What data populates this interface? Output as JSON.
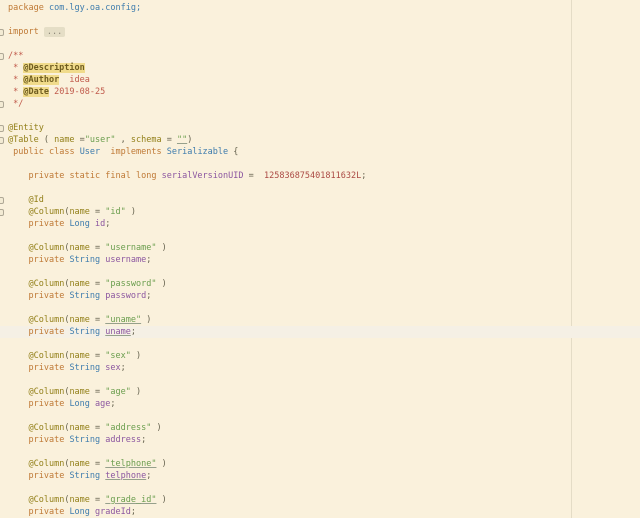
{
  "app": {
    "title": "code-editor-viewport"
  },
  "colors": {
    "background": "#FAF1DC",
    "caret_line": "#F5F0E5",
    "keyword": "#BF7935",
    "reference_type": "#3E7CAD",
    "annotation": "#93801A",
    "string": "#6B9E4E",
    "field": "#8C57A0",
    "number": "#AB4A44",
    "doc_comment": "#C05A4B",
    "doc_tag_text": "#6F5D20",
    "doc_tag_bg": "#F0DB8B",
    "punctuation": "#66634F",
    "margin_guide": "#E4DCC6"
  },
  "editor": {
    "language": "java",
    "caret_line_index": 27,
    "margin_guide_x": 571,
    "fold_marker_lines": [
      2,
      4,
      8,
      10,
      11,
      16,
      17
    ],
    "folded_imports_placeholder": "...",
    "lines": [
      {
        "tokens": [
          {
            "t": "kw",
            "s": "package"
          },
          {
            "t": "pln",
            "s": " "
          },
          {
            "t": "ref",
            "s": "com.lgy.oa.config;"
          }
        ]
      },
      {
        "tokens": []
      },
      {
        "tokens": [
          {
            "t": "kw",
            "s": "import"
          },
          {
            "t": "pln",
            "s": " "
          },
          {
            "t": "fold",
            "s": "..."
          }
        ]
      },
      {
        "tokens": []
      },
      {
        "tokens": [
          {
            "t": "doc",
            "s": "/**"
          }
        ]
      },
      {
        "tokens": [
          {
            "t": "doc",
            "s": " * "
          },
          {
            "t": "tag",
            "s": "@Description"
          }
        ]
      },
      {
        "tokens": [
          {
            "t": "doc",
            "s": " * "
          },
          {
            "t": "tag",
            "s": "@Author"
          },
          {
            "t": "doc",
            "s": "  idea"
          }
        ]
      },
      {
        "tokens": [
          {
            "t": "doc",
            "s": " * "
          },
          {
            "t": "tag",
            "s": "@Date"
          },
          {
            "t": "doc",
            "s": " 2019-08-25"
          }
        ]
      },
      {
        "tokens": [
          {
            "t": "doc",
            "s": " */"
          }
        ]
      },
      {
        "tokens": []
      },
      {
        "tokens": [
          {
            "t": "ann",
            "s": "@Entity"
          }
        ]
      },
      {
        "tokens": [
          {
            "t": "ann",
            "s": "@Table"
          },
          {
            "t": "pln",
            "s": " ( "
          },
          {
            "t": "ann",
            "s": "name"
          },
          {
            "t": "pln",
            "s": " ="
          },
          {
            "t": "str",
            "s": "\"user\""
          },
          {
            "t": "pln",
            "s": " , "
          },
          {
            "t": "ann",
            "s": "schema"
          },
          {
            "t": "pln",
            "s": " = "
          },
          {
            "t": "str",
            "s": "\"\"",
            "u": true
          },
          {
            "t": "pln",
            "s": ")"
          }
        ]
      },
      {
        "tokens": [
          {
            "t": "pln",
            "s": " "
          },
          {
            "t": "kw",
            "s": "public"
          },
          {
            "t": "pln",
            "s": " "
          },
          {
            "t": "kw",
            "s": "class"
          },
          {
            "t": "pln",
            "s": " "
          },
          {
            "t": "ref",
            "s": "User"
          },
          {
            "t": "pln",
            "s": "  "
          },
          {
            "t": "kw",
            "s": "implements"
          },
          {
            "t": "pln",
            "s": " "
          },
          {
            "t": "ref",
            "s": "Serializable"
          },
          {
            "t": "pln",
            "s": " {"
          }
        ]
      },
      {
        "tokens": []
      },
      {
        "tokens": [
          {
            "t": "pln",
            "s": "    "
          },
          {
            "t": "kw",
            "s": "private"
          },
          {
            "t": "pln",
            "s": " "
          },
          {
            "t": "kw",
            "s": "static"
          },
          {
            "t": "pln",
            "s": " "
          },
          {
            "t": "kw",
            "s": "final"
          },
          {
            "t": "pln",
            "s": " "
          },
          {
            "t": "kw",
            "s": "long"
          },
          {
            "t": "pln",
            "s": " "
          },
          {
            "t": "fld",
            "s": "serialVersionUID"
          },
          {
            "t": "pln",
            "s": " =  "
          },
          {
            "t": "num",
            "s": "125836875401811632L"
          },
          {
            "t": "pln",
            "s": ";"
          }
        ]
      },
      {
        "tokens": []
      },
      {
        "tokens": [
          {
            "t": "pln",
            "s": "    "
          },
          {
            "t": "ann",
            "s": "@Id"
          }
        ]
      },
      {
        "tokens": [
          {
            "t": "pln",
            "s": "    "
          },
          {
            "t": "ann",
            "s": "@Column"
          },
          {
            "t": "pln",
            "s": "("
          },
          {
            "t": "ann",
            "s": "name"
          },
          {
            "t": "pln",
            "s": " = "
          },
          {
            "t": "str",
            "s": "\"id\""
          },
          {
            "t": "pln",
            "s": " )"
          }
        ]
      },
      {
        "tokens": [
          {
            "t": "pln",
            "s": "    "
          },
          {
            "t": "kw",
            "s": "private"
          },
          {
            "t": "pln",
            "s": " "
          },
          {
            "t": "ref",
            "s": "Long"
          },
          {
            "t": "pln",
            "s": " "
          },
          {
            "t": "fld",
            "s": "id"
          },
          {
            "t": "pln",
            "s": ";"
          }
        ]
      },
      {
        "tokens": []
      },
      {
        "tokens": [
          {
            "t": "pln",
            "s": "    "
          },
          {
            "t": "ann",
            "s": "@Column"
          },
          {
            "t": "pln",
            "s": "("
          },
          {
            "t": "ann",
            "s": "name"
          },
          {
            "t": "pln",
            "s": " = "
          },
          {
            "t": "str",
            "s": "\"username\""
          },
          {
            "t": "pln",
            "s": " )"
          }
        ]
      },
      {
        "tokens": [
          {
            "t": "pln",
            "s": "    "
          },
          {
            "t": "kw",
            "s": "private"
          },
          {
            "t": "pln",
            "s": " "
          },
          {
            "t": "ref",
            "s": "String"
          },
          {
            "t": "pln",
            "s": " "
          },
          {
            "t": "fld",
            "s": "username"
          },
          {
            "t": "pln",
            "s": ";"
          }
        ]
      },
      {
        "tokens": []
      },
      {
        "tokens": [
          {
            "t": "pln",
            "s": "    "
          },
          {
            "t": "ann",
            "s": "@Column"
          },
          {
            "t": "pln",
            "s": "("
          },
          {
            "t": "ann",
            "s": "name"
          },
          {
            "t": "pln",
            "s": " = "
          },
          {
            "t": "str",
            "s": "\"password\""
          },
          {
            "t": "pln",
            "s": " )"
          }
        ]
      },
      {
        "tokens": [
          {
            "t": "pln",
            "s": "    "
          },
          {
            "t": "kw",
            "s": "private"
          },
          {
            "t": "pln",
            "s": " "
          },
          {
            "t": "ref",
            "s": "String"
          },
          {
            "t": "pln",
            "s": " "
          },
          {
            "t": "fld",
            "s": "password"
          },
          {
            "t": "pln",
            "s": ";"
          }
        ]
      },
      {
        "tokens": []
      },
      {
        "tokens": [
          {
            "t": "pln",
            "s": "    "
          },
          {
            "t": "ann",
            "s": "@Column"
          },
          {
            "t": "pln",
            "s": "("
          },
          {
            "t": "ann",
            "s": "name"
          },
          {
            "t": "pln",
            "s": " = "
          },
          {
            "t": "str",
            "s": "\"uname\"",
            "u": true
          },
          {
            "t": "pln",
            "s": " )"
          }
        ]
      },
      {
        "tokens": [
          {
            "t": "pln",
            "s": "    "
          },
          {
            "t": "kw",
            "s": "private"
          },
          {
            "t": "pln",
            "s": " "
          },
          {
            "t": "ref",
            "s": "String"
          },
          {
            "t": "pln",
            "s": " "
          },
          {
            "t": "fld",
            "s": "uname",
            "u": true
          },
          {
            "t": "pln",
            "s": ";"
          }
        ]
      },
      {
        "tokens": []
      },
      {
        "tokens": [
          {
            "t": "pln",
            "s": "    "
          },
          {
            "t": "ann",
            "s": "@Column"
          },
          {
            "t": "pln",
            "s": "("
          },
          {
            "t": "ann",
            "s": "name"
          },
          {
            "t": "pln",
            "s": " = "
          },
          {
            "t": "str",
            "s": "\"sex\""
          },
          {
            "t": "pln",
            "s": " )"
          }
        ]
      },
      {
        "tokens": [
          {
            "t": "pln",
            "s": "    "
          },
          {
            "t": "kw",
            "s": "private"
          },
          {
            "t": "pln",
            "s": " "
          },
          {
            "t": "ref",
            "s": "String"
          },
          {
            "t": "pln",
            "s": " "
          },
          {
            "t": "fld",
            "s": "sex"
          },
          {
            "t": "pln",
            "s": ";"
          }
        ]
      },
      {
        "tokens": []
      },
      {
        "tokens": [
          {
            "t": "pln",
            "s": "    "
          },
          {
            "t": "ann",
            "s": "@Column"
          },
          {
            "t": "pln",
            "s": "("
          },
          {
            "t": "ann",
            "s": "name"
          },
          {
            "t": "pln",
            "s": " = "
          },
          {
            "t": "str",
            "s": "\"age\""
          },
          {
            "t": "pln",
            "s": " )"
          }
        ]
      },
      {
        "tokens": [
          {
            "t": "pln",
            "s": "    "
          },
          {
            "t": "kw",
            "s": "private"
          },
          {
            "t": "pln",
            "s": " "
          },
          {
            "t": "ref",
            "s": "Long"
          },
          {
            "t": "pln",
            "s": " "
          },
          {
            "t": "fld",
            "s": "age"
          },
          {
            "t": "pln",
            "s": ";"
          }
        ]
      },
      {
        "tokens": []
      },
      {
        "tokens": [
          {
            "t": "pln",
            "s": "    "
          },
          {
            "t": "ann",
            "s": "@Column"
          },
          {
            "t": "pln",
            "s": "("
          },
          {
            "t": "ann",
            "s": "name"
          },
          {
            "t": "pln",
            "s": " = "
          },
          {
            "t": "str",
            "s": "\"address\""
          },
          {
            "t": "pln",
            "s": " )"
          }
        ]
      },
      {
        "tokens": [
          {
            "t": "pln",
            "s": "    "
          },
          {
            "t": "kw",
            "s": "private"
          },
          {
            "t": "pln",
            "s": " "
          },
          {
            "t": "ref",
            "s": "String"
          },
          {
            "t": "pln",
            "s": " "
          },
          {
            "t": "fld",
            "s": "address"
          },
          {
            "t": "pln",
            "s": ";"
          }
        ]
      },
      {
        "tokens": []
      },
      {
        "tokens": [
          {
            "t": "pln",
            "s": "    "
          },
          {
            "t": "ann",
            "s": "@Column"
          },
          {
            "t": "pln",
            "s": "("
          },
          {
            "t": "ann",
            "s": "name"
          },
          {
            "t": "pln",
            "s": " = "
          },
          {
            "t": "str",
            "s": "\"telphone\"",
            "u": true
          },
          {
            "t": "pln",
            "s": " )"
          }
        ]
      },
      {
        "tokens": [
          {
            "t": "pln",
            "s": "    "
          },
          {
            "t": "kw",
            "s": "private"
          },
          {
            "t": "pln",
            "s": " "
          },
          {
            "t": "ref",
            "s": "String"
          },
          {
            "t": "pln",
            "s": " "
          },
          {
            "t": "fld",
            "s": "telphone",
            "u": true
          },
          {
            "t": "pln",
            "s": ";"
          }
        ]
      },
      {
        "tokens": []
      },
      {
        "tokens": [
          {
            "t": "pln",
            "s": "    "
          },
          {
            "t": "ann",
            "s": "@Column"
          },
          {
            "t": "pln",
            "s": "("
          },
          {
            "t": "ann",
            "s": "name"
          },
          {
            "t": "pln",
            "s": " = "
          },
          {
            "t": "str",
            "s": "\"grade_id\"",
            "u": true
          },
          {
            "t": "pln",
            "s": " )"
          }
        ]
      },
      {
        "tokens": [
          {
            "t": "pln",
            "s": "    "
          },
          {
            "t": "kw",
            "s": "private"
          },
          {
            "t": "pln",
            "s": " "
          },
          {
            "t": "ref",
            "s": "Long"
          },
          {
            "t": "pln",
            "s": " "
          },
          {
            "t": "fld",
            "s": "gradeId"
          },
          {
            "t": "pln",
            "s": ";"
          }
        ]
      }
    ]
  }
}
